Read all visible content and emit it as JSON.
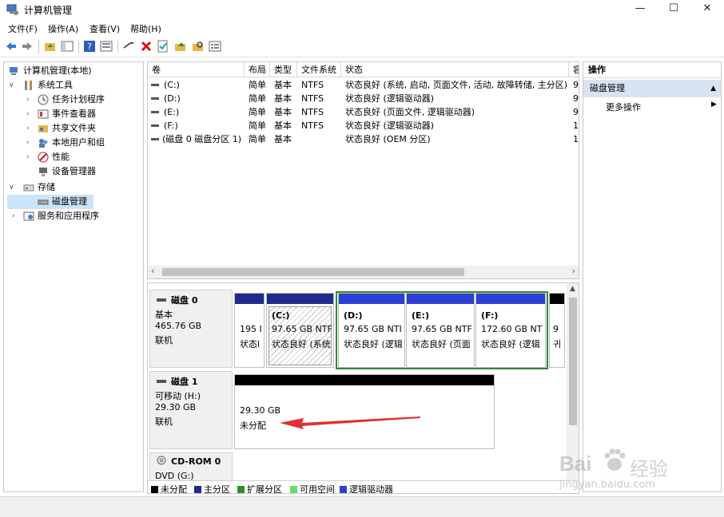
{
  "window": {
    "title": "计算机管理",
    "controls": {
      "minimize": "—",
      "maximize": "☐",
      "close": "✕"
    }
  },
  "menu": [
    "文件(F)",
    "操作(A)",
    "查看(V)",
    "帮助(H)"
  ],
  "tree": {
    "root": "计算机管理(本地)",
    "system_tools": "系统工具",
    "task_scheduler": "任务计划程序",
    "event_viewer": "事件查看器",
    "shared_folders": "共享文件夹",
    "local_users": "本地用户和组",
    "performance": "性能",
    "device_manager": "设备管理器",
    "storage": "存储",
    "disk_management": "磁盘管理",
    "services": "服务和应用程序"
  },
  "volumes": {
    "headers": [
      "卷",
      "布局",
      "类型",
      "文件系统",
      "状态",
      "容"
    ],
    "rows": [
      {
        "vol": "(C:)",
        "layout": "简单",
        "type": "基本",
        "fs": "NTFS",
        "status": "状态良好 (系统, 启动, 页面文件, 活动, 故障转储, 主分区)",
        "cap": "9"
      },
      {
        "vol": "(D:)",
        "layout": "简单",
        "type": "基本",
        "fs": "NTFS",
        "status": "状态良好 (逻辑驱动器)",
        "cap": "9"
      },
      {
        "vol": "(E:)",
        "layout": "简单",
        "type": "基本",
        "fs": "NTFS",
        "status": "状态良好 (页面文件, 逻辑驱动器)",
        "cap": "9"
      },
      {
        "vol": "(F:)",
        "layout": "简单",
        "type": "基本",
        "fs": "NTFS",
        "status": "状态良好 (逻辑驱动器)",
        "cap": "1"
      },
      {
        "vol": "(磁盘 0 磁盘分区 1)",
        "layout": "简单",
        "type": "基本",
        "fs": "",
        "status": "状态良好 (OEM 分区)",
        "cap": "1"
      }
    ]
  },
  "disks": {
    "disk0": {
      "name": "磁盘 0",
      "kind": "基本",
      "size": "465.76 GB",
      "state": "联机",
      "partitions": [
        {
          "title": "",
          "size": "195 I",
          "status": "状态l"
        },
        {
          "title": "(C:)",
          "size": "97.65 GB NTF",
          "status": "状态良好 (系统"
        },
        {
          "title": "(D:)",
          "size": "97.65 GB NTI",
          "status": "状态良好 (逻辑"
        },
        {
          "title": "(E:)",
          "size": "97.65 GB NTF",
          "status": "状态良好 (页面"
        },
        {
          "title": "(F:)",
          "size": "172.60 GB NT",
          "status": "状态良好 (逻辑"
        },
        {
          "title": "",
          "size": "9",
          "status": "귀"
        }
      ]
    },
    "disk1": {
      "name": "磁盘 1",
      "kind": "可移动 (H:)",
      "size": "29.30 GB",
      "state": "联机",
      "partition": {
        "size": "29.30 GB",
        "status": "未分配"
      }
    },
    "cdrom": {
      "name": "CD-ROM 0",
      "kind": "DVD (G:)"
    }
  },
  "legend": [
    {
      "label": "未分配",
      "color": "#000000"
    },
    {
      "label": "主分区",
      "color": "#1f2a8c"
    },
    {
      "label": "扩展分区",
      "color": "#2e8b2e"
    },
    {
      "label": "可用空间",
      "color": "#66dd66"
    },
    {
      "label": "逻辑驱动器",
      "color": "#2b3fd6"
    }
  ],
  "actions": {
    "title": "操作",
    "group": "磁盘管理",
    "more": "更多操作"
  },
  "watermark": {
    "brand": "Bai",
    "brand2": "经验",
    "url": "jingyan.baidu.com"
  },
  "colors": {
    "primary": "#1f2a8c",
    "logical": "#2b3fd6",
    "extended": "#2e8b2e",
    "unallocated": "#000000",
    "arrow": "#e03030"
  }
}
